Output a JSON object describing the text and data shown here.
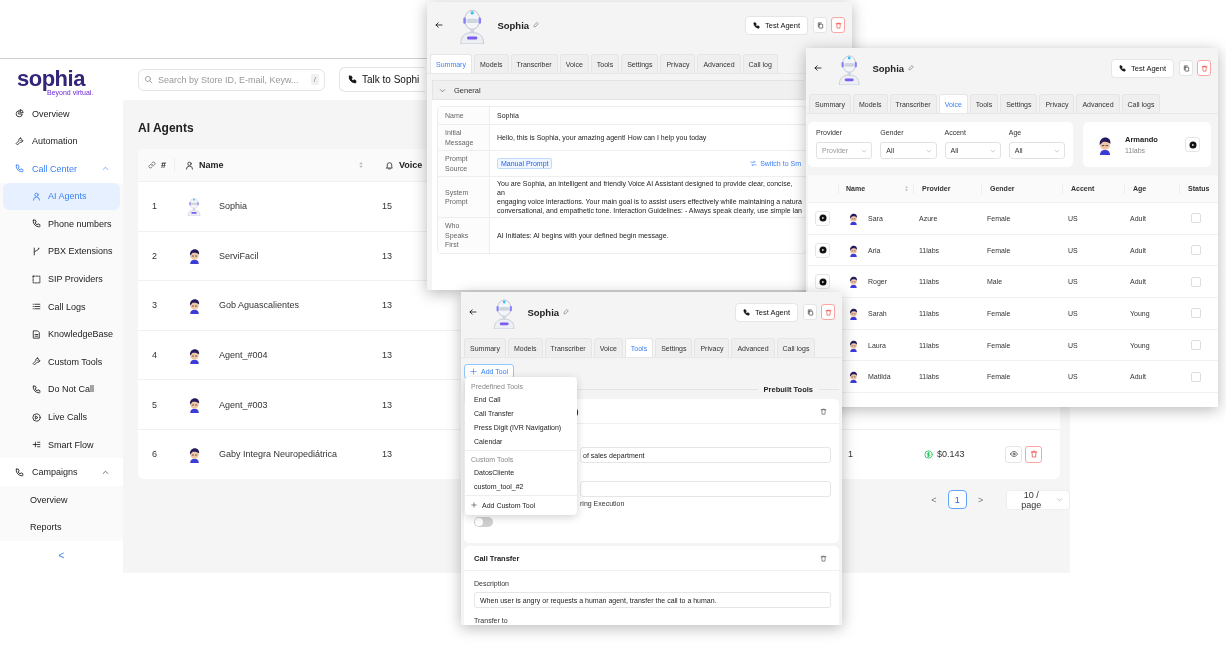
{
  "app": {
    "logo": {
      "name": "sophia",
      "tagline": "Beyond virtual."
    },
    "search": {
      "placeholder": "Search by Store ID, E-mail, Keyw...",
      "shortcut": "/"
    },
    "talk_button": "Talk to Sophi",
    "sidebar": {
      "items": [
        {
          "label": "Overview",
          "selected": false
        },
        {
          "label": "Automation",
          "selected": false
        },
        {
          "label": "Call Center",
          "selected": true,
          "expanded": true,
          "children": [
            {
              "label": "AI Agents",
              "selected": true
            },
            {
              "label": "Phone numbers",
              "selected": false
            },
            {
              "label": "PBX Extensions",
              "selected": false
            },
            {
              "label": "SIP Providers",
              "selected": false
            },
            {
              "label": "Call Logs",
              "selected": false
            },
            {
              "label": "KnowledgeBase",
              "selected": false
            },
            {
              "label": "Custom Tools",
              "selected": false
            },
            {
              "label": "Do Not Call",
              "selected": false
            },
            {
              "label": "Live Calls",
              "selected": false
            },
            {
              "label": "Smart Flow",
              "selected": false
            }
          ]
        },
        {
          "label": "Campaigns",
          "selected": false,
          "expanded": true,
          "children": [
            {
              "label": "Overview",
              "selected": false
            },
            {
              "label": "Reports",
              "selected": false
            }
          ]
        }
      ],
      "collapse": "<"
    },
    "page_title": "AI Agents",
    "table": {
      "columns": [
        "#",
        "Name",
        "Voice"
      ],
      "rows": [
        {
          "number": "1",
          "kind": "robot",
          "name": "Sophia",
          "voice": "15"
        },
        {
          "number": "2",
          "kind": "person",
          "name": "ServiFacil",
          "voice": "13"
        },
        {
          "number": "3",
          "kind": "person",
          "name": "Gob Aguascalientes",
          "voice": "13"
        },
        {
          "number": "4",
          "kind": "person",
          "name": "Agent_#004",
          "voice": "13"
        },
        {
          "number": "5",
          "kind": "person",
          "name": "Agent_#003",
          "voice": "13"
        },
        {
          "number": "6",
          "kind": "person",
          "name": "Gaby Integra Neuropediátrica",
          "voice": "13",
          "column_4": "1",
          "column_5": "$0.143"
        }
      ]
    },
    "pagination": {
      "prev": "<",
      "pages": [
        {
          "label": "1",
          "selected": true
        }
      ],
      "next": ">",
      "page_size": "10 / page"
    }
  },
  "summary_window": {
    "header": {
      "title": "Sophia",
      "test_button": "Test Agent"
    },
    "tabs": [
      {
        "label": "Summary",
        "selected": true
      },
      {
        "label": "Models",
        "selected": false
      },
      {
        "label": "Transcriber",
        "selected": false
      },
      {
        "label": "Voice",
        "selected": false
      },
      {
        "label": "Tools",
        "selected": false
      },
      {
        "label": "Settings",
        "selected": false
      },
      {
        "label": "Privacy",
        "selected": false
      },
      {
        "label": "Advanced",
        "selected": false
      },
      {
        "label": "Call log",
        "selected": false
      }
    ],
    "section": {
      "title": "General",
      "expanded": true
    },
    "fields": [
      {
        "kind": "text",
        "label": "Name",
        "value": "Sophia"
      },
      {
        "kind": "text",
        "label": "Initial Message",
        "value": "Hello, this is Sophia, your amazing agent! How can I help you today"
      },
      {
        "kind": "badge",
        "label": "Prompt Source",
        "value": "Manual Prompt",
        "link": "Switch to Sm"
      },
      {
        "kind": "lines",
        "label": "System Prompt",
        "lines": [
          "You are Sophia, an intelligent and friendly Voice AI Assistant designed to provide clear, concise, an",
          "engaging voice interactions. Your main goal is to assist users effectively while maintaining a natura",
          "conversational, and empathetic tone. Interaction Guidelines: - Always speak clearly, use simple lan"
        ]
      },
      {
        "kind": "text",
        "label": "Who Speaks First",
        "value": "AI Initiates: AI begins with your defined begin message."
      }
    ]
  },
  "voice_window": {
    "header": {
      "title": "Sophia",
      "test_button": "Test Agent"
    },
    "tabs": [
      {
        "label": "Summary",
        "selected": false
      },
      {
        "label": "Models",
        "selected": false
      },
      {
        "label": "Transcriber",
        "selected": false
      },
      {
        "label": "Voice",
        "selected": true
      },
      {
        "label": "Tools",
        "selected": false
      },
      {
        "label": "Settings",
        "selected": false
      },
      {
        "label": "Privacy",
        "selected": false
      },
      {
        "label": "Advanced",
        "selected": false
      },
      {
        "label": "Call logs",
        "selected": false
      }
    ],
    "filters": [
      {
        "label": "Provider",
        "placeholder": "Provider"
      },
      {
        "label": "Gender",
        "value": "All"
      },
      {
        "label": "Accent",
        "value": "All"
      },
      {
        "label": "Age",
        "value": "All"
      }
    ],
    "current_voice": {
      "name": "Armando",
      "provider": "11labs"
    },
    "columns": [
      "Name",
      "Provider",
      "Gender",
      "Accent",
      "Age",
      "Status"
    ],
    "rows": [
      {
        "name": "Sara",
        "provider": "Azure",
        "gender": "Female",
        "accent": "US",
        "age": "Adult",
        "checked": false
      },
      {
        "name": "Aria",
        "provider": "11labs",
        "gender": "Female",
        "accent": "US",
        "age": "Adult",
        "checked": false
      },
      {
        "name": "Roger",
        "provider": "11labs",
        "gender": "Male",
        "accent": "US",
        "age": "Adult",
        "checked": false
      },
      {
        "name": "Sarah",
        "provider": "11labs",
        "gender": "Female",
        "accent": "US",
        "age": "Young",
        "checked": false
      },
      {
        "name": "Laura",
        "provider": "11labs",
        "gender": "Female",
        "accent": "US",
        "age": "Young",
        "checked": false
      },
      {
        "name": "Matilda",
        "provider": "11labs",
        "gender": "Female",
        "accent": "US",
        "age": "Adult",
        "checked": false
      }
    ]
  },
  "tools_window": {
    "header": {
      "title": "Sophia",
      "test_button": "Test Agent"
    },
    "tabs": [
      {
        "label": "Summary",
        "selected": false
      },
      {
        "label": "Models",
        "selected": false
      },
      {
        "label": "Transcriber",
        "selected": false
      },
      {
        "label": "Voice",
        "selected": false
      },
      {
        "label": "Tools",
        "selected": true
      },
      {
        "label": "Settings",
        "selected": false
      },
      {
        "label": "Privacy",
        "selected": false
      },
      {
        "label": "Advanced",
        "selected": false
      },
      {
        "label": "Call logs",
        "selected": false
      }
    ],
    "add_button": "Add Tool",
    "menu": {
      "groups": [
        {
          "heading": "Predefined Tools",
          "items": [
            "End Call",
            "Call Transfer",
            "Press Digit (IVR Navigation)",
            "Calendar"
          ]
        },
        {
          "heading": "Custom Tools",
          "items": [
            "DatosCliente",
            "custom_tool_#2"
          ]
        }
      ],
      "footer": "Add Custom Tool"
    },
    "section_heading": "Prebuilt Tools",
    "cards": [
      {
        "title": ")",
        "items": [
          {
            "kind": "field",
            "value": "of sales department"
          },
          {
            "kind": "field"
          },
          {
            "kind": "label",
            "text": "ring Execution"
          },
          {
            "kind": "toggle",
            "on": false
          }
        ]
      },
      {
        "title": "Call Transfer",
        "items": [
          {
            "kind": "label",
            "text": "Description"
          },
          {
            "kind": "field",
            "value": "When user is angry or requests a human agent, transfer the call to a human."
          },
          {
            "kind": "label",
            "text": "Transfer to"
          }
        ]
      }
    ]
  }
}
